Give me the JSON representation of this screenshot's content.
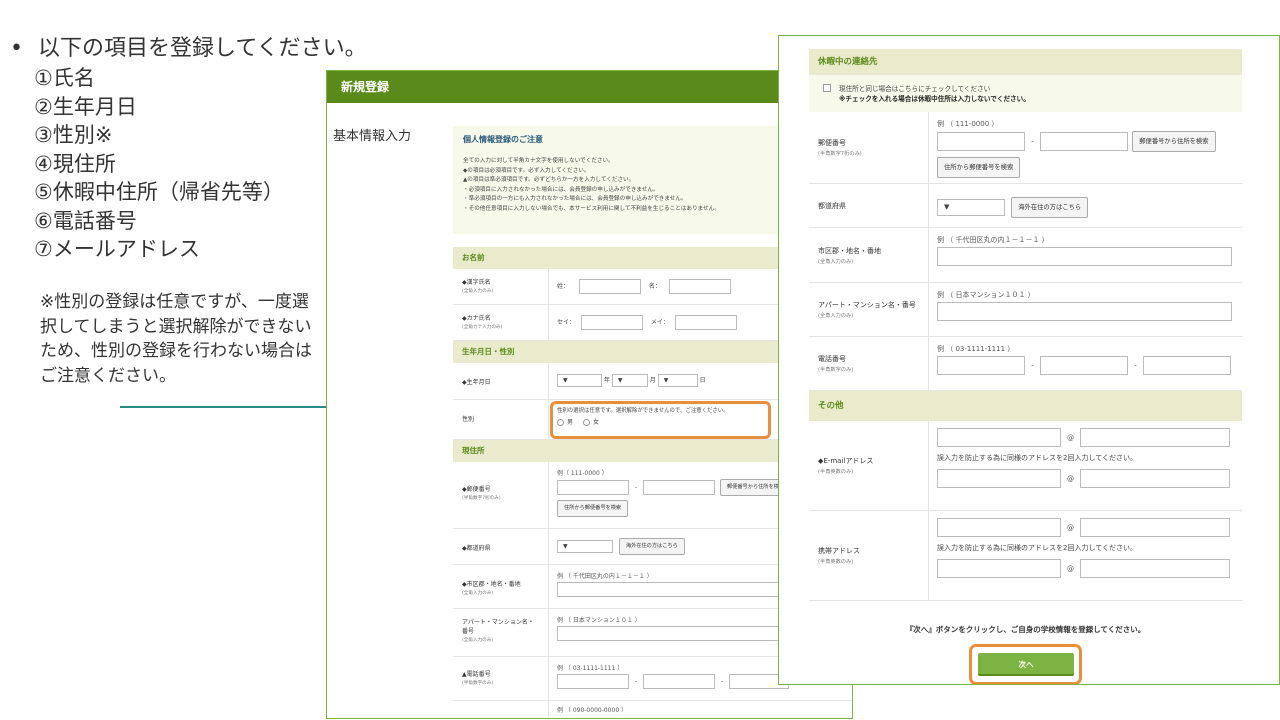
{
  "slide": {
    "title": "以下の項目を登録してください。",
    "items": [
      "①氏名",
      "②生年月日",
      "③性別※",
      "④現住所",
      "⑤休暇中住所（帰省先等）",
      "⑥電話番号",
      "⑦メールアドレス"
    ],
    "note": "※性別の登録は任意ですが、一度選択してしまうと選択解除ができないため、性別の登録を行わない場合はご注意ください。"
  },
  "form1": {
    "header": "新規登録",
    "section": "基本情報入力",
    "notice_title": "個人情報登録のご注意",
    "notice_lines": [
      "全ての入力に対して半角カナ文字を使用しないでください。",
      "◆の項目は必須項目です。必ず入力してください。",
      "▲の項目は準必須項目です。必ずどちらか一方を入力してください。",
      "・必須項目に入力されなかった場合には、会員登録の申し込みができません。",
      "・準必須項目の一方にも入力されなかった場合には、会員登録の申し込みができません。",
      "・その他任意項目に入力しない場合でも、本サービス利用に関して不利益を生じることはありません。"
    ],
    "name_group": "お名前",
    "kanji_label": "◆漢字氏名",
    "kanji_sub": "(全角入力のみ)",
    "sei": "姓：",
    "mei": "名：",
    "kana_label": "◆カナ氏名",
    "kana_sub": "(全角カナ入力のみ)",
    "sei_kana": "セイ：",
    "mei_kana": "メイ：",
    "birth_group": "生年月日・性別",
    "birth_label": "◆生年月日",
    "year_select": "▼",
    "year": "年",
    "month_select": "▼",
    "month": "月",
    "day_select": "▼",
    "day": "日",
    "sex_label": "性別",
    "sex_note": "性別の選択は任意です。選択解除ができませんので、ご注意ください。",
    "male": "男",
    "female": "女",
    "address_group": "現住所",
    "zip_label": "◆郵便番号",
    "zip_sub": "(半角数字7桁のみ)",
    "zip_example": "例（ 111-0000 ）",
    "zip_search_btn": "郵便番号から住所を検索",
    "addr_to_zip_btn": "住所から郵便番号を検索",
    "pref_label": "◆都道府県",
    "pref_select": "▼",
    "overseas_btn": "海外在住の方はこちら",
    "city_label": "◆市区郡・地名・番地",
    "city_sub": "(全角入力のみ)",
    "city_example": "例 （ 千代田区丸の内１－１－１ ）",
    "apt_label": "アパート・マンション名・番号",
    "apt_sub": "(全角入力のみ)",
    "apt_example": "例 （ 日本マンション１０１ ）",
    "tel_label": "▲電話番号",
    "tel_sub": "(半角数字のみ)",
    "tel_example": "例 （ 03-1111-1111 ）",
    "dash": "-",
    "bottom_example": "例 （ 090-0000-0000 ）"
  },
  "form2": {
    "vacation_group": "休暇中の連絡先",
    "same_check": "現住所と同じ場合はこちらにチェックしてください",
    "same_check_note": "※チェックを入れる場合は休暇中住所は入力しないでください。",
    "zip_label": "郵便番号",
    "zip_sub": "(半角数字7桁のみ)",
    "zip_example": "例 （ 111-0000 ）",
    "zip_search_btn": "郵便番号から住所を検索",
    "addr_to_zip_btn": "住所から郵便番号を検索",
    "pref_label": "都道府県",
    "pref_select": "▼",
    "overseas_btn": "海外在住の方はこちら",
    "city_label": "市区郡・地名・番地",
    "city_sub": "(全角入力のみ)",
    "city_example": "例 （ 千代田区丸の内１－１－１ ）",
    "apt_label": "アパート・マンション名・番号",
    "apt_sub": "(全角入力のみ)",
    "apt_example": "例 （ 日本マンション１０１ ）",
    "tel_label": "電話番号",
    "tel_sub": "(半角数字のみ)",
    "tel_example": "例 （ 03-1111-1111 ）",
    "dash": "-",
    "other_group": "その他",
    "email_label": "◆E-mailアドレス",
    "email_sub": "(半角英数のみ)",
    "at": "@",
    "confirm_note": "誤入力を防止する為に同様のアドレスを2回入力してください。",
    "mobile_label": "携帯アドレス",
    "mobile_sub": "(半角英数のみ)",
    "next_text": "『次へ』ボタンをクリックし、ご自身の学校情報を登録してください。",
    "next_btn": "次へ"
  },
  "colors": {
    "header_green": "#5a8a1a",
    "button_green": "#7cb342",
    "highlight_orange": "#e88f3c",
    "callout_teal": "#2a8a86"
  }
}
